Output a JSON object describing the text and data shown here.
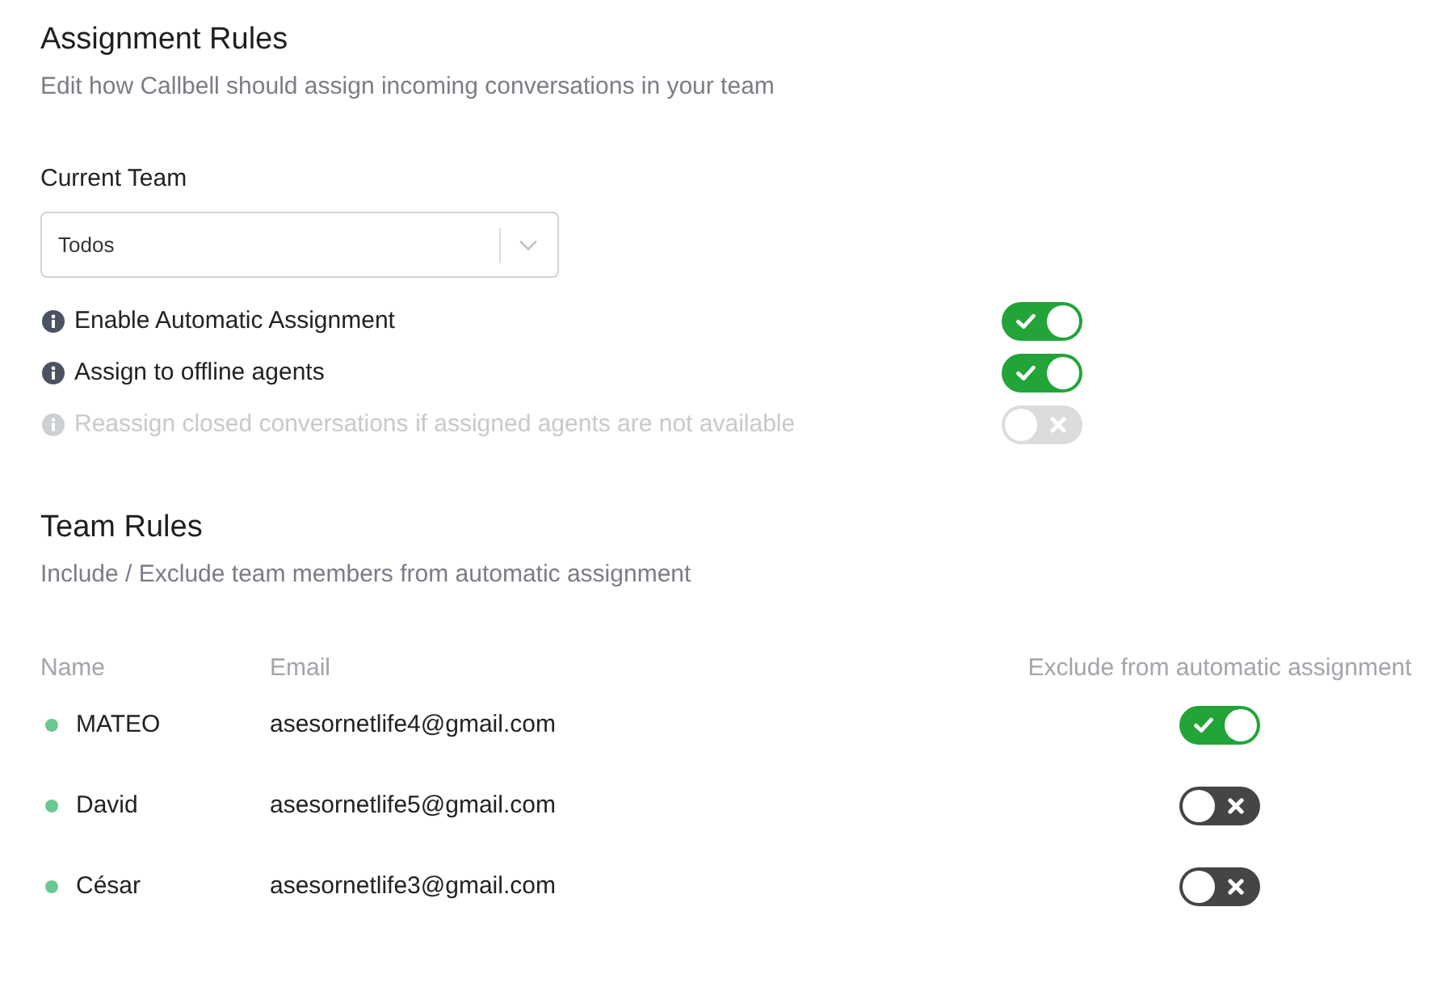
{
  "assignment_rules": {
    "title": "Assignment Rules",
    "subtitle": "Edit how Callbell should assign incoming conversations in your team",
    "current_team": {
      "label": "Current Team",
      "value": "Todos"
    },
    "settings": [
      {
        "label": "Enable Automatic Assignment",
        "on": true,
        "disabled": false
      },
      {
        "label": "Assign to offline agents",
        "on": true,
        "disabled": false
      },
      {
        "label": "Reassign closed conversations if assigned agents are not available",
        "on": false,
        "disabled": true
      }
    ]
  },
  "team_rules": {
    "title": "Team Rules",
    "subtitle": "Include / Exclude team members from automatic assignment",
    "table": {
      "columns": [
        "Name",
        "Email",
        "Exclude from automatic assignment"
      ],
      "rows": [
        {
          "name": "MATEO",
          "email": "asesornetlife4@gmail.com",
          "color": "#6cc790",
          "excluded": true
        },
        {
          "name": "David",
          "email": "asesornetlife5@gmail.com",
          "color": "#6cc790",
          "excluded": false
        },
        {
          "name": "César",
          "email": "asesornetlife3@gmail.com",
          "color": "#6cc790",
          "excluded": false
        }
      ]
    }
  }
}
